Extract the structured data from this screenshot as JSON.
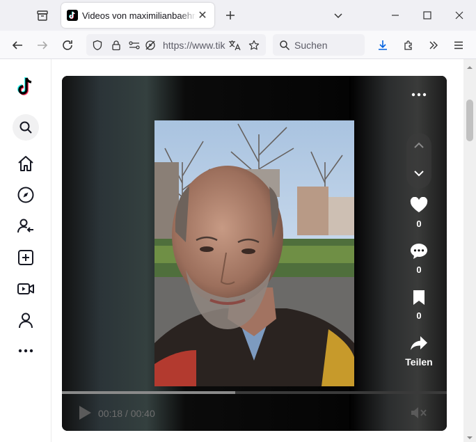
{
  "browser": {
    "tab_title": "Videos von maximilianbaehring",
    "url": "https://www.tik",
    "search_placeholder": "Suchen"
  },
  "sidebar": {
    "items": [
      "tiktok-logo-icon",
      "search-icon",
      "home-icon",
      "explore-icon",
      "following-icon",
      "upload-icon",
      "live-icon",
      "profile-icon",
      "more-icon"
    ]
  },
  "player": {
    "time": "00:18 / 00:40",
    "progress": 0.45,
    "likes": "0",
    "comments": "0",
    "saves": "0",
    "share_label": "Teilen"
  },
  "colors": {
    "accent_blue": "#0061e0",
    "tiktok_cyan": "#25f4ee",
    "tiktok_red": "#fe2c55"
  }
}
